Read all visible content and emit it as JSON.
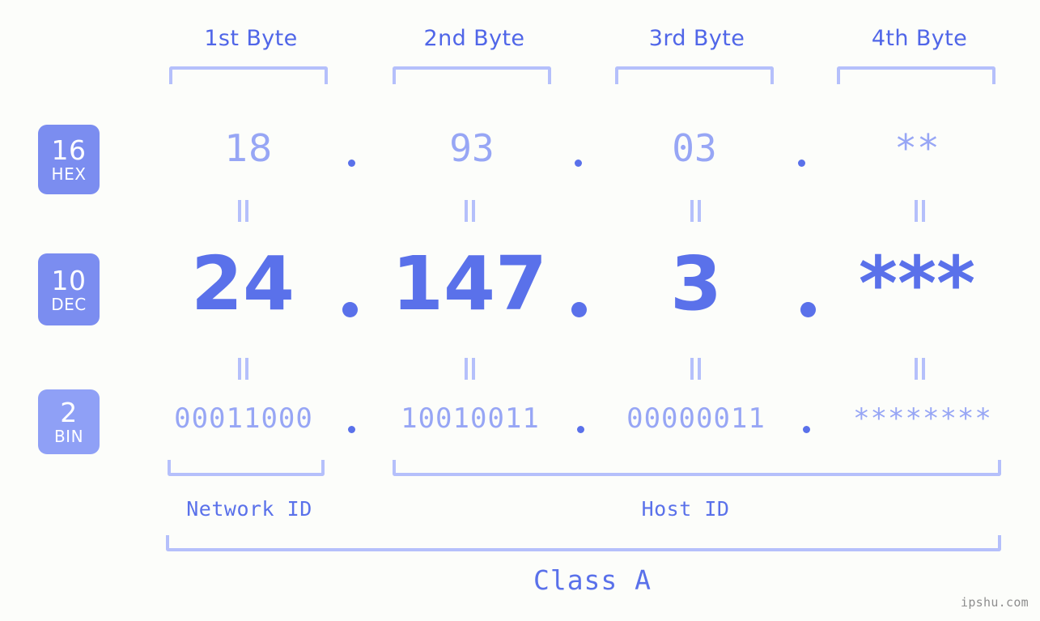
{
  "background_color": "#fcfdfa",
  "accent_colors": {
    "strong_blue": "#5a71ea",
    "light_blue": "#97a6f5",
    "bracket_blue": "#b5c0fb",
    "badge_blue": "#7b8df0",
    "badge_blue_light": "#8fa0f6",
    "header_blue": "#5066e8",
    "watermark_gray": "#8e8e8e"
  },
  "headers": {
    "bytes": [
      {
        "label": "1st Byte"
      },
      {
        "label": "2nd Byte"
      },
      {
        "label": "3rd Byte"
      },
      {
        "label": "4th Byte"
      }
    ]
  },
  "bases": [
    {
      "number": "16",
      "name": "HEX"
    },
    {
      "number": "10",
      "name": "DEC"
    },
    {
      "number": "2",
      "name": "BIN"
    }
  ],
  "rows": {
    "hex": {
      "base_number": "16",
      "base_name": "HEX",
      "values": [
        "18",
        "93",
        "03",
        "**"
      ]
    },
    "dec": {
      "base_number": "10",
      "base_name": "DEC",
      "values": [
        "24",
        "147",
        "3",
        "***"
      ]
    },
    "bin": {
      "base_number": "2",
      "base_name": "BIN",
      "values": [
        "00011000",
        "10010011",
        "00000011",
        "********"
      ]
    }
  },
  "separators": {
    "dot": ".",
    "equals": "="
  },
  "sections": {
    "network_id": "Network ID",
    "host_id": "Host ID",
    "class": "Class A"
  },
  "watermark": "ipshu.com"
}
